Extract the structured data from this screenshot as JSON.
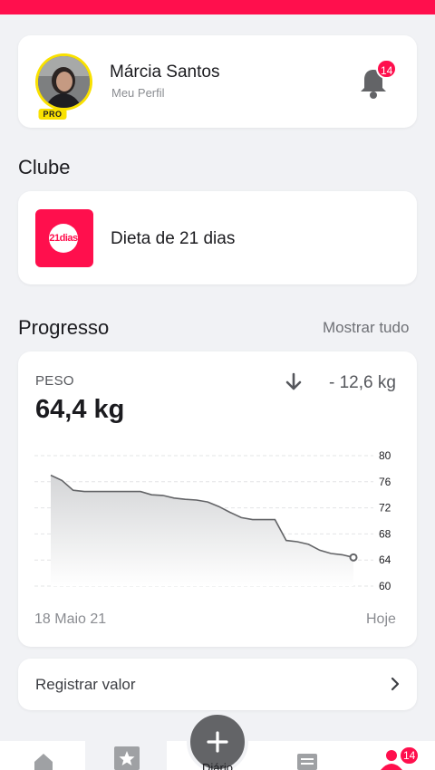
{
  "profile": {
    "name": "Márcia Santos",
    "subtitle": "Meu Perfil",
    "badge": "PRO",
    "notification_count": "14"
  },
  "clube": {
    "title": "Clube",
    "items": [
      {
        "label": "Dieta de 21 dias",
        "logo_text": "21dias"
      }
    ]
  },
  "progress": {
    "title": "Progresso",
    "show_all": "Mostrar tudo",
    "metric": {
      "label": "PESO",
      "value": "64,4 kg",
      "delta": "- 12,6 kg",
      "trend_icon": "arrow-down-icon",
      "start_label": "18 Maio 21",
      "end_label": "Hoje"
    }
  },
  "register": {
    "label": "Registrar valor"
  },
  "bottom_nav": {
    "fab_caption": "Diário",
    "profile_badge": "14",
    "icons": [
      "home-icon",
      "star-icon",
      "add-icon",
      "list-icon",
      "user-icon"
    ]
  },
  "colors": {
    "accent": "#ff0f4d",
    "pro_badge": "#f9e100",
    "background": "#f1f2f5",
    "fab": "#636467"
  },
  "chart_data": {
    "type": "area",
    "title": "",
    "xlabel": "",
    "ylabel": "",
    "y_ticks": [
      "80",
      "76",
      "72",
      "68",
      "64",
      "60"
    ],
    "ylim": [
      60,
      80
    ],
    "y_axis_position": "right",
    "grid": true,
    "x_range_labels": [
      "18 Maio 21",
      "Hoje"
    ],
    "series": [
      {
        "values": [
          77.0,
          76.2,
          74.7,
          74.5,
          74.5,
          74.5,
          74.5,
          74.5,
          74.5,
          74.0,
          73.9,
          73.5,
          73.3,
          73.2,
          72.9,
          72.2,
          71.3,
          70.5,
          70.2,
          70.2,
          70.2,
          67.0,
          66.8,
          66.4,
          65.5,
          65.0,
          64.8,
          64.4
        ]
      }
    ]
  }
}
